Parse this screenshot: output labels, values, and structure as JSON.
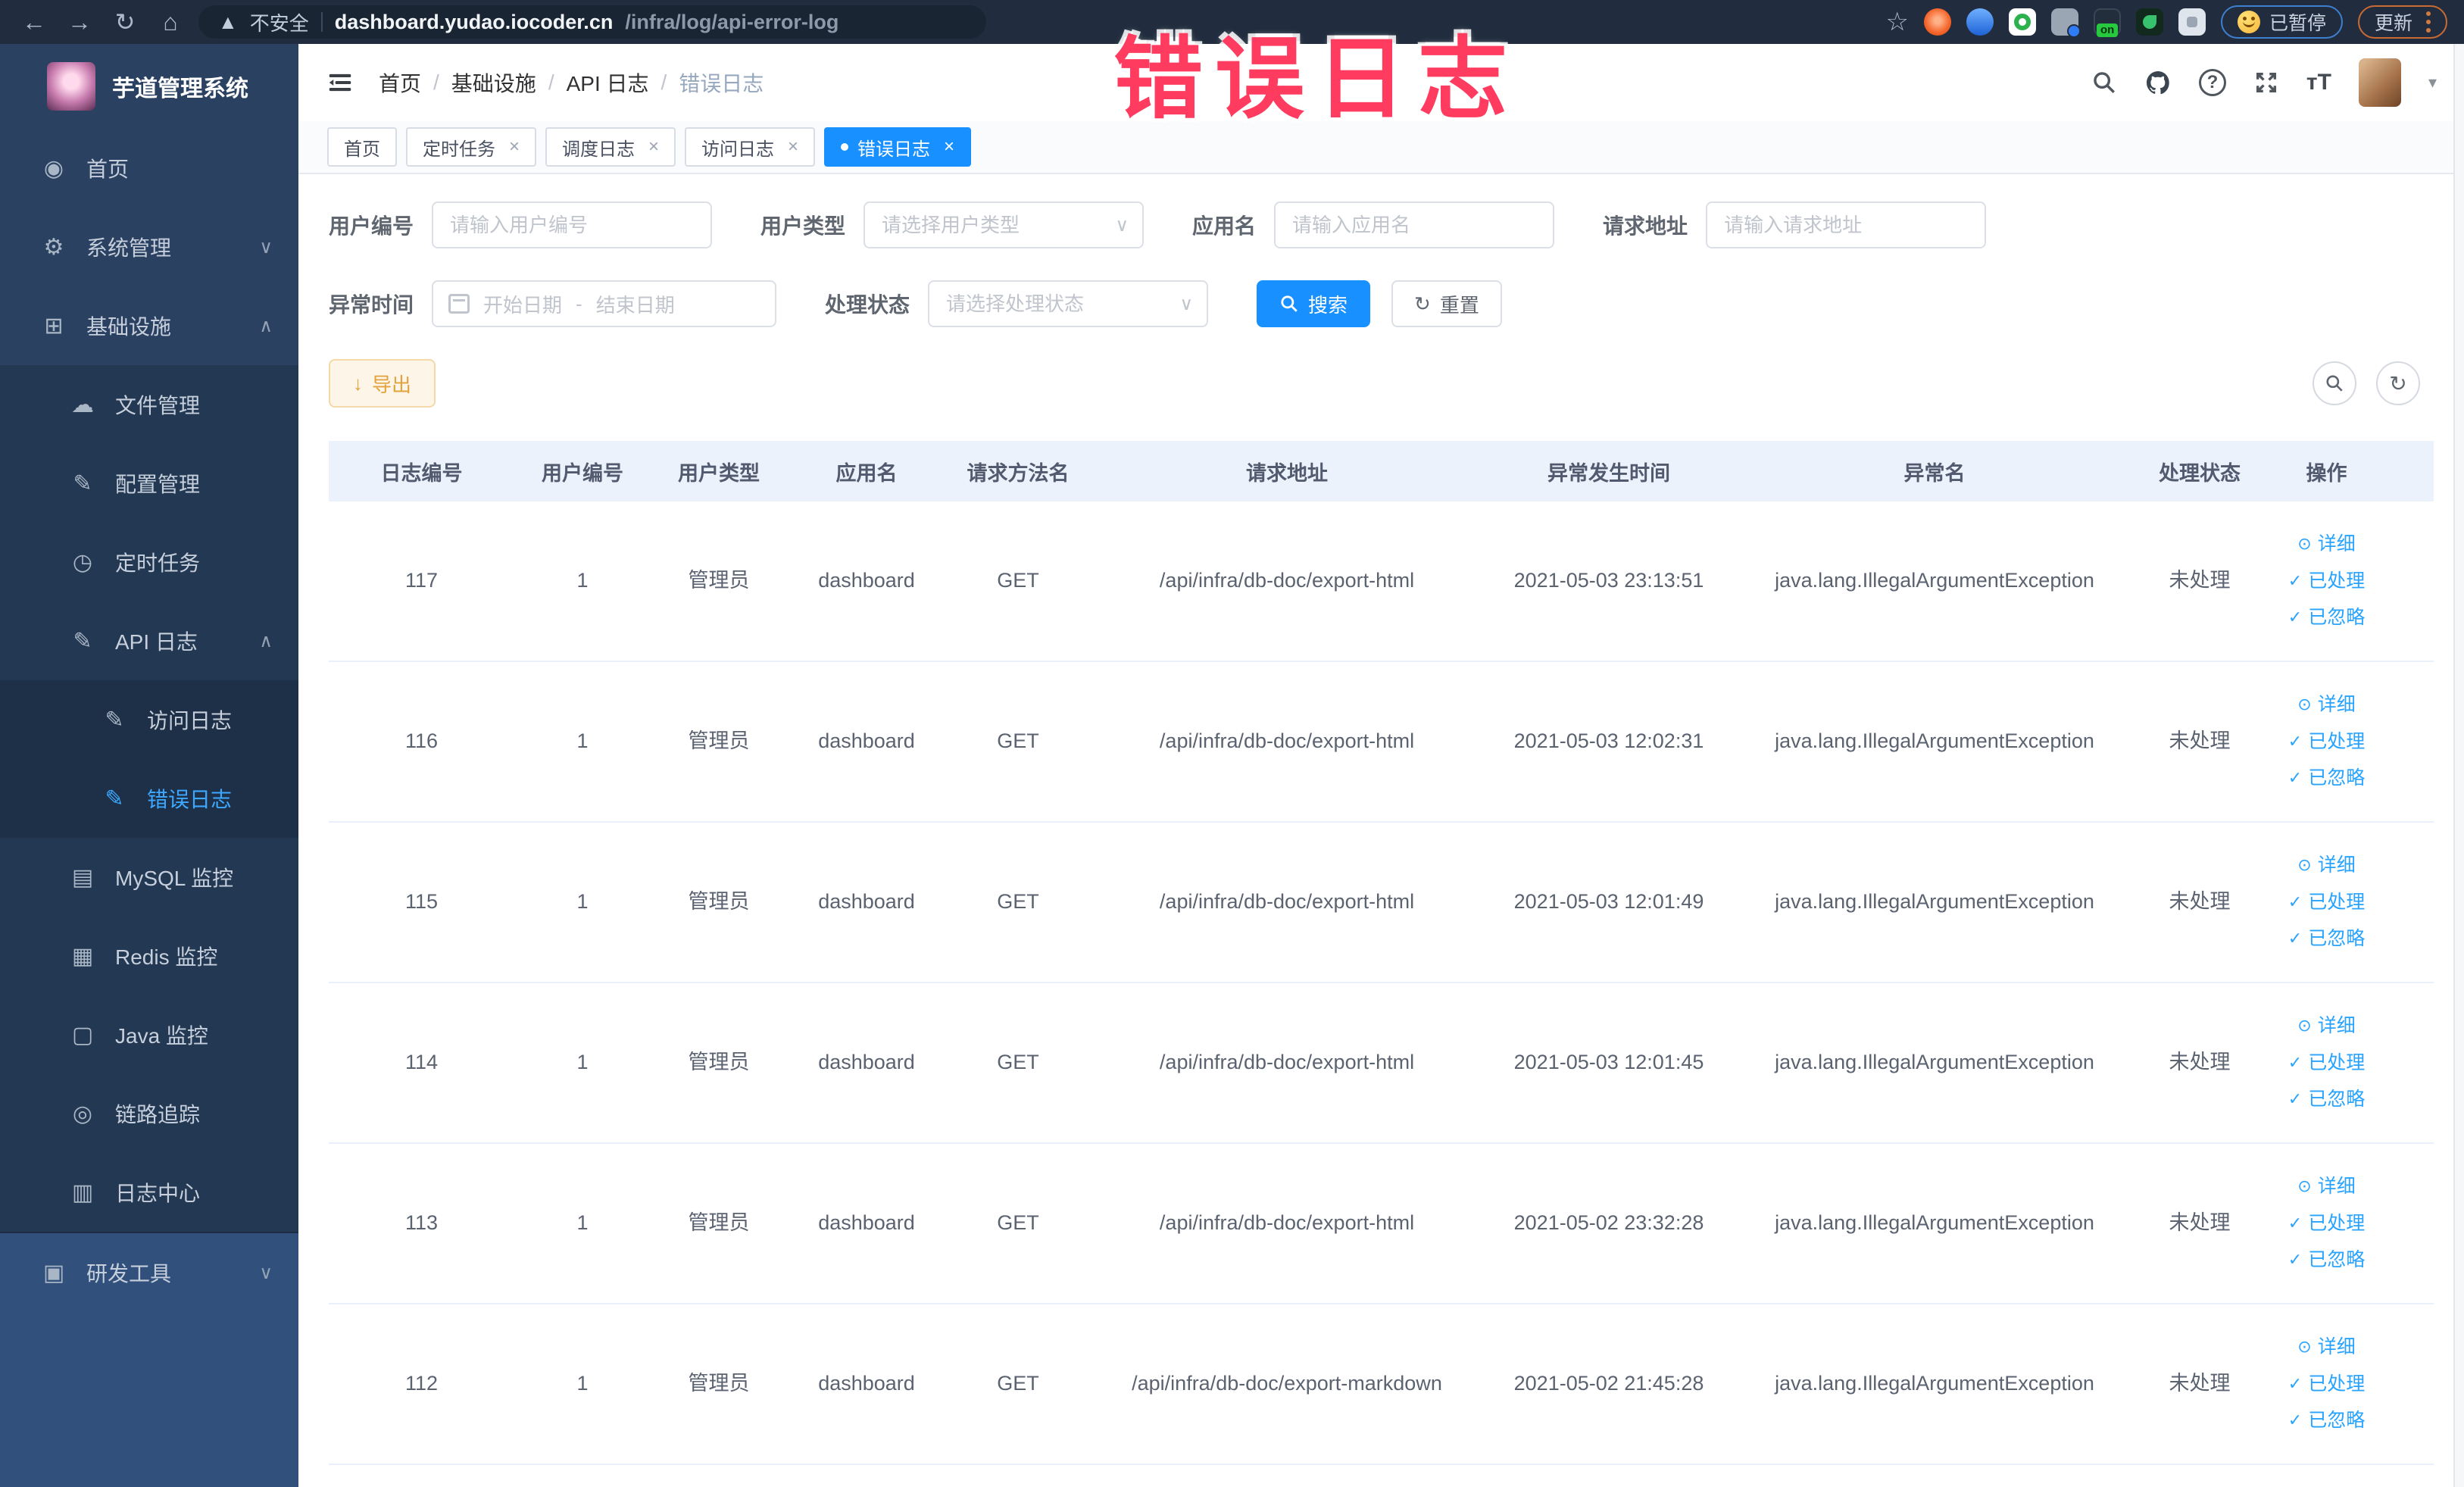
{
  "browser": {
    "security_label": "不安全",
    "url_domain": "dashboard.yudao.iocoder.cn",
    "url_path": "/infra/log/api-error-log",
    "paused_badge": "已暂停",
    "update_label": "更新"
  },
  "watermark": "错误日志",
  "sidebar": {
    "logo_title": "芋道管理系统",
    "items": [
      {
        "label": "首页",
        "level": 1,
        "icon": "dashboard-icon"
      },
      {
        "label": "系统管理",
        "level": 1,
        "icon": "gear-icon",
        "chevron": "down"
      },
      {
        "label": "基础设施",
        "level": 1,
        "icon": "infrastructure-icon",
        "chevron": "up"
      },
      {
        "label": "文件管理",
        "level": 2,
        "icon": "cloud-upload-icon"
      },
      {
        "label": "配置管理",
        "level": 2,
        "icon": "config-edit-icon"
      },
      {
        "label": "定时任务",
        "level": 2,
        "icon": "schedule-task-icon"
      },
      {
        "label": "API 日志",
        "level": 2,
        "icon": "api-log-icon",
        "chevron": "up"
      },
      {
        "label": "访问日志",
        "level": 3,
        "icon": "access-log-icon"
      },
      {
        "label": "错误日志",
        "level": 3,
        "icon": "error-log-icon",
        "active": true
      },
      {
        "label": "MySQL 监控",
        "level": 2,
        "icon": "mysql-monitor-icon"
      },
      {
        "label": "Redis 监控",
        "level": 2,
        "icon": "redis-monitor-icon"
      },
      {
        "label": "Java 监控",
        "level": 2,
        "icon": "java-monitor-icon"
      },
      {
        "label": "链路追踪",
        "level": 2,
        "icon": "trace-icon"
      },
      {
        "label": "日志中心",
        "level": 2,
        "icon": "log-center-icon"
      },
      {
        "label": "研发工具",
        "level": 1,
        "icon": "devtools-icon",
        "chevron": "down",
        "section": "bottom"
      }
    ]
  },
  "breadcrumb": [
    "首页",
    "基础设施",
    "API 日志",
    "错误日志"
  ],
  "tabs": [
    {
      "label": "首页",
      "closable": false,
      "active": false
    },
    {
      "label": "定时任务",
      "closable": true,
      "active": false
    },
    {
      "label": "调度日志",
      "closable": true,
      "active": false
    },
    {
      "label": "访问日志",
      "closable": true,
      "active": false
    },
    {
      "label": "错误日志",
      "closable": true,
      "active": true
    }
  ],
  "filters": {
    "user_id": {
      "label": "用户编号",
      "placeholder": "请输入用户编号"
    },
    "user_type": {
      "label": "用户类型",
      "placeholder": "请选择用户类型"
    },
    "app_name": {
      "label": "应用名",
      "placeholder": "请输入应用名"
    },
    "request_url": {
      "label": "请求地址",
      "placeholder": "请输入请求地址"
    },
    "exception_time": {
      "label": "异常时间",
      "start_placeholder": "开始日期",
      "separator": "-",
      "end_placeholder": "结束日期"
    },
    "process_status": {
      "label": "处理状态",
      "placeholder": "请选择处理状态"
    },
    "search_label": "搜索",
    "reset_label": "重置"
  },
  "toolbar": {
    "export_label": "导出"
  },
  "table": {
    "columns": [
      "日志编号",
      "用户编号",
      "用户类型",
      "应用名",
      "请求方法名",
      "请求地址",
      "异常发生时间",
      "异常名",
      "处理状态",
      "操作"
    ],
    "row_actions": [
      "详细",
      "已处理",
      "已忽略"
    ],
    "rows": [
      {
        "log_id": "117",
        "user_id": "1",
        "user_type": "管理员",
        "app_name": "dashboard",
        "method": "GET",
        "request_url": "/api/infra/db-doc/export-html",
        "exception_time": "2021-05-03 23:13:51",
        "exception_name": "java.lang.IllegalArgumentException",
        "status": "未处理"
      },
      {
        "log_id": "116",
        "user_id": "1",
        "user_type": "管理员",
        "app_name": "dashboard",
        "method": "GET",
        "request_url": "/api/infra/db-doc/export-html",
        "exception_time": "2021-05-03 12:02:31",
        "exception_name": "java.lang.IllegalArgumentException",
        "status": "未处理"
      },
      {
        "log_id": "115",
        "user_id": "1",
        "user_type": "管理员",
        "app_name": "dashboard",
        "method": "GET",
        "request_url": "/api/infra/db-doc/export-html",
        "exception_time": "2021-05-03 12:01:49",
        "exception_name": "java.lang.IllegalArgumentException",
        "status": "未处理"
      },
      {
        "log_id": "114",
        "user_id": "1",
        "user_type": "管理员",
        "app_name": "dashboard",
        "method": "GET",
        "request_url": "/api/infra/db-doc/export-html",
        "exception_time": "2021-05-03 12:01:45",
        "exception_name": "java.lang.IllegalArgumentException",
        "status": "未处理"
      },
      {
        "log_id": "113",
        "user_id": "1",
        "user_type": "管理员",
        "app_name": "dashboard",
        "method": "GET",
        "request_url": "/api/infra/db-doc/export-html",
        "exception_time": "2021-05-02 23:32:28",
        "exception_name": "java.lang.IllegalArgumentException",
        "status": "未处理"
      },
      {
        "log_id": "112",
        "user_id": "1",
        "user_type": "管理员",
        "app_name": "dashboard",
        "method": "GET",
        "request_url": "/api/infra/db-doc/export-markdown",
        "exception_time": "2021-05-02 21:45:28",
        "exception_name": "java.lang.IllegalArgumentException",
        "status": "未处理"
      }
    ]
  },
  "colors": {
    "accent": "#1890ff",
    "active_menu": "#3da8ff",
    "warning": "#e6a23c",
    "watermark": "#ff3c5f"
  }
}
